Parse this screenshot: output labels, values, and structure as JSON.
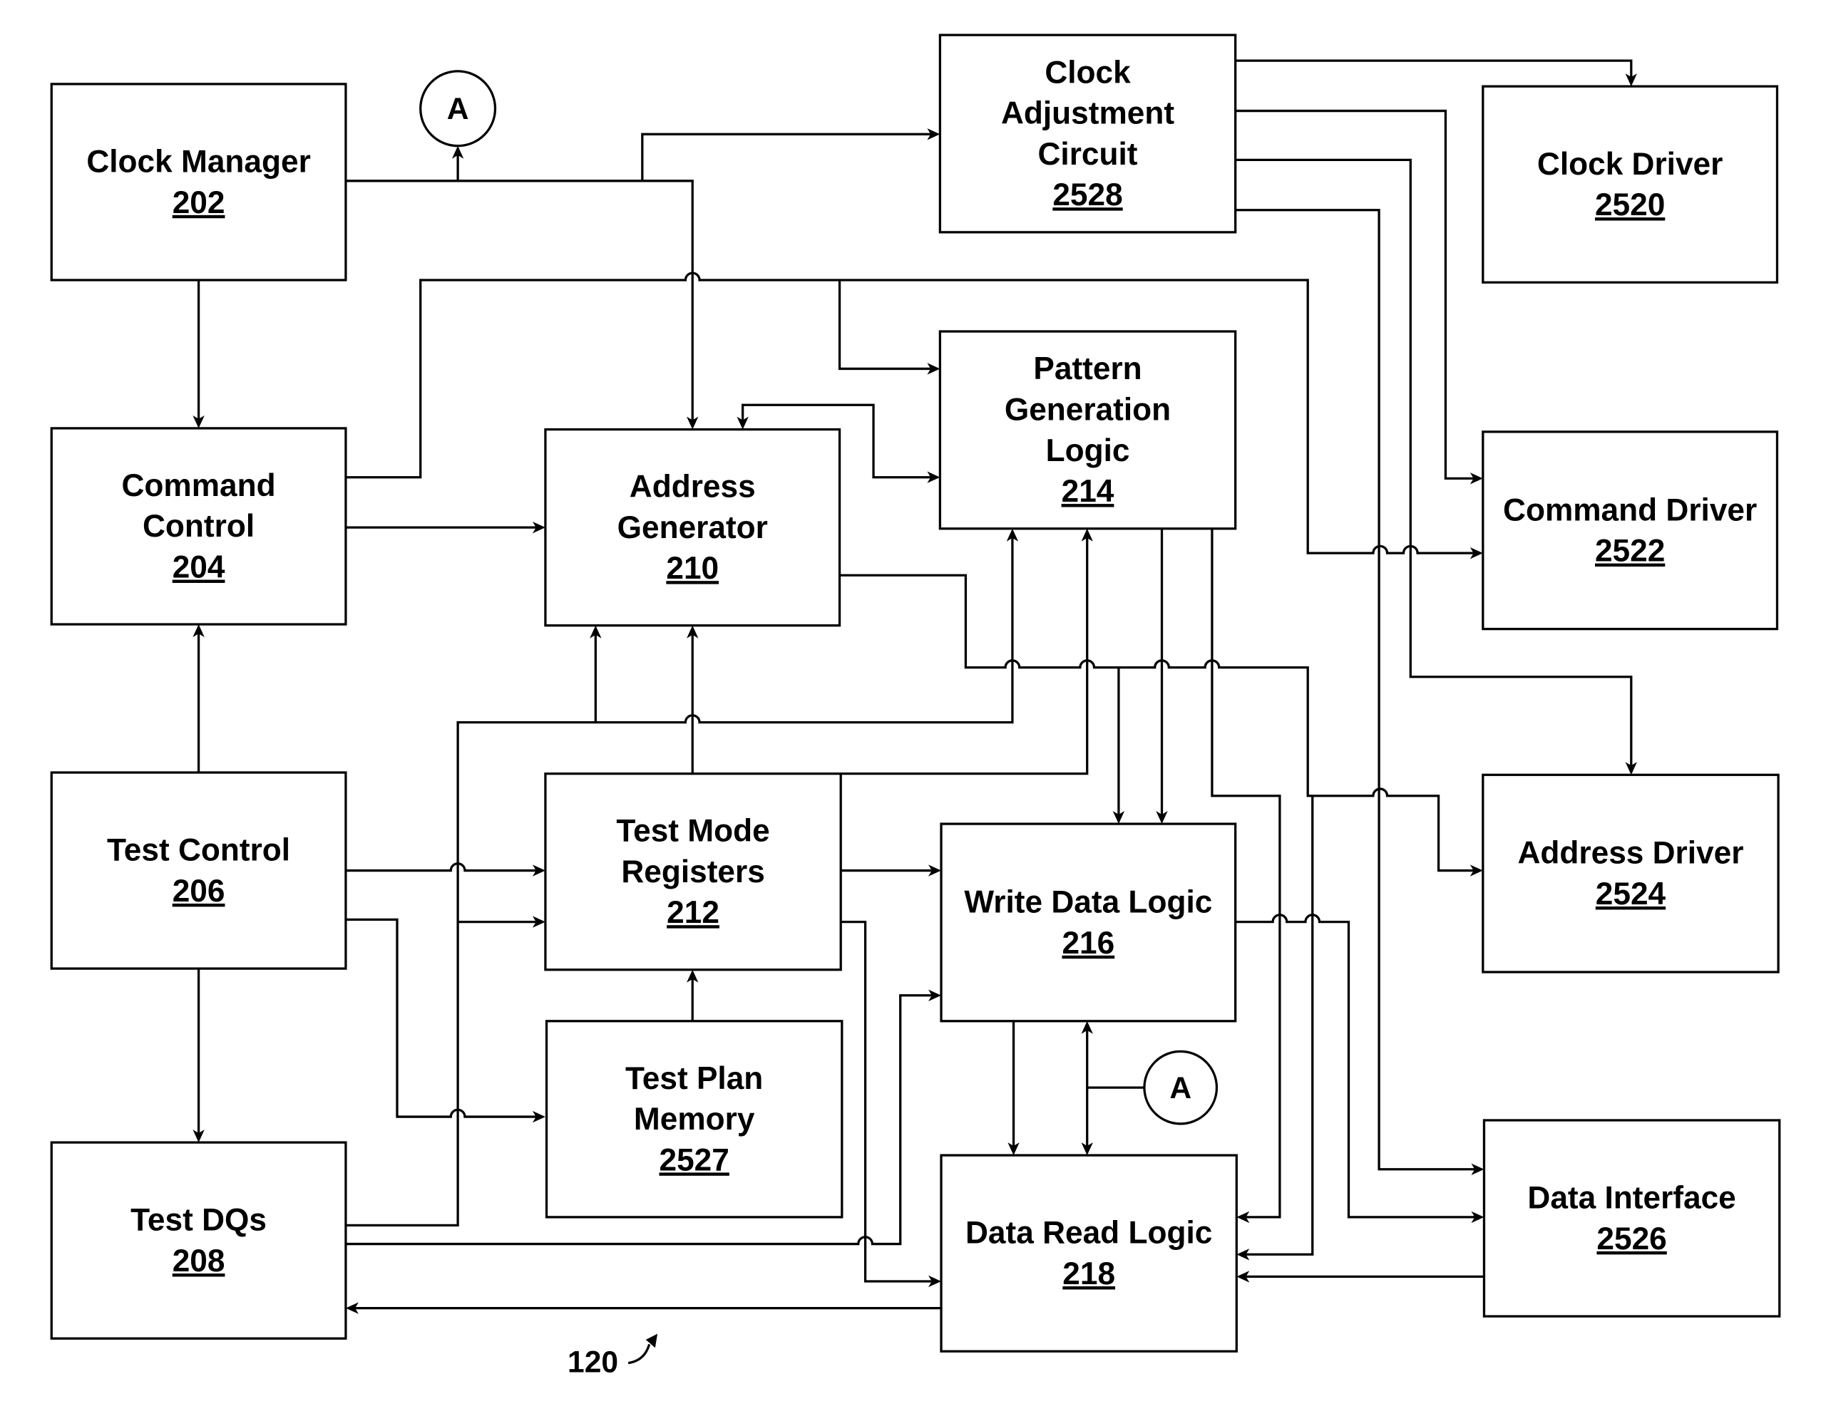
{
  "figure": {
    "reference_numeral": "120"
  },
  "blocks": {
    "clock_manager": {
      "lines": [
        "Clock Manager"
      ],
      "ref": "202"
    },
    "command_control": {
      "lines": [
        "Command",
        "Control"
      ],
      "ref": "204"
    },
    "test_control": {
      "lines": [
        "Test Control"
      ],
      "ref": "206"
    },
    "test_dqs": {
      "lines": [
        "Test DQs"
      ],
      "ref": "208"
    },
    "address_generator": {
      "lines": [
        "Address",
        "Generator"
      ],
      "ref": "210"
    },
    "test_mode_registers": {
      "lines": [
        "Test Mode",
        "Registers"
      ],
      "ref": "212"
    },
    "test_plan_memory": {
      "lines": [
        "Test Plan",
        "Memory"
      ],
      "ref": "2527"
    },
    "clock_adjustment_circuit": {
      "lines": [
        "Clock",
        "Adjustment",
        "Circuit"
      ],
      "ref": "2528"
    },
    "pattern_generation_logic": {
      "lines": [
        "Pattern",
        "Generation",
        "Logic"
      ],
      "ref": "214"
    },
    "write_data_logic": {
      "lines": [
        "Write Data Logic"
      ],
      "ref": "216"
    },
    "data_read_logic": {
      "lines": [
        "Data Read Logic"
      ],
      "ref": "218"
    },
    "clock_driver": {
      "lines": [
        "Clock Driver"
      ],
      "ref": "2520"
    },
    "command_driver": {
      "lines": [
        "Command Driver"
      ],
      "ref": "2522"
    },
    "address_driver": {
      "lines": [
        "Address Driver"
      ],
      "ref": "2524"
    },
    "data_interface": {
      "lines": [
        "Data Interface"
      ],
      "ref": "2526"
    }
  },
  "connectors": {
    "top": {
      "label": "A"
    },
    "bottom": {
      "label": "A"
    }
  },
  "connections": [
    {
      "from": "clock_manager",
      "to": "command_control"
    },
    {
      "from": "clock_manager",
      "to": "connector_A"
    },
    {
      "from": "clock_manager",
      "to": "clock_adjustment_circuit"
    },
    {
      "from": "clock_manager",
      "to": "address_generator"
    },
    {
      "from": "command_control",
      "to": "address_generator"
    },
    {
      "from": "command_control",
      "to": "pattern_generation_logic"
    },
    {
      "from": "command_control",
      "to": "command_driver"
    },
    {
      "from": "test_control",
      "to": "command_control"
    },
    {
      "from": "test_control",
      "to": "test_mode_registers"
    },
    {
      "from": "test_control",
      "to": "test_plan_memory"
    },
    {
      "from": "test_control",
      "to": "test_dqs"
    },
    {
      "from": "test_dqs",
      "to": "test_mode_registers"
    },
    {
      "from": "test_dqs",
      "to": "address_generator"
    },
    {
      "from": "test_dqs",
      "to": "pattern_generation_logic"
    },
    {
      "from": "test_dqs",
      "to": "write_data_logic"
    },
    {
      "from": "data_read_logic",
      "to": "test_dqs"
    },
    {
      "from": "test_mode_registers",
      "to": "address_generator"
    },
    {
      "from": "test_mode_registers",
      "to": "pattern_generation_logic"
    },
    {
      "from": "test_mode_registers",
      "to": "write_data_logic"
    },
    {
      "from": "test_mode_registers",
      "to": "data_read_logic"
    },
    {
      "from": "test_plan_memory",
      "to": "test_mode_registers"
    },
    {
      "from": "pattern_generation_logic",
      "to": "address_generator"
    },
    {
      "from": "pattern_generation_logic",
      "to": "write_data_logic"
    },
    {
      "from": "pattern_generation_logic",
      "to": "data_read_logic"
    },
    {
      "from": "address_generator",
      "to": "write_data_logic"
    },
    {
      "from": "address_generator",
      "to": "address_driver"
    },
    {
      "from": "clock_adjustment_circuit",
      "to": "clock_driver"
    },
    {
      "from": "clock_adjustment_circuit",
      "to": "command_driver"
    },
    {
      "from": "clock_adjustment_circuit",
      "to": "address_driver"
    },
    {
      "from": "clock_adjustment_circuit",
      "to": "data_interface"
    },
    {
      "from": "write_data_logic",
      "to": "data_read_logic"
    },
    {
      "from": "write_data_logic",
      "to": "data_interface"
    },
    {
      "from": "write_data_logic",
      "to": "data_read_logic"
    },
    {
      "from": "data_interface",
      "to": "data_read_logic"
    },
    {
      "from": "connector_A",
      "to": "write_data_logic"
    },
    {
      "from": "connector_A",
      "to": "data_read_logic"
    }
  ]
}
